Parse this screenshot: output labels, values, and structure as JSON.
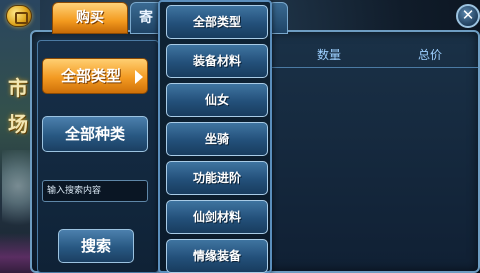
{
  "tabs": {
    "buy": "购买",
    "consign": "寄"
  },
  "market_title": [
    "市",
    "场"
  ],
  "filters": {
    "all_types": "全部类型",
    "all_kinds": "全部种类",
    "search_placeholder": "输入搜索内容",
    "search_button": "搜索"
  },
  "table_header": {
    "quantity": "数量",
    "total_price": "总价"
  },
  "dropdown_items": [
    "全部类型",
    "装备材料",
    "仙女",
    "坐骑",
    "功能进阶",
    "仙剑材料",
    "情缘装备"
  ],
  "colors": {
    "accent_orange": "#f39a1e",
    "panel_blue": "#1a3147",
    "header_text": "#9dd0ff"
  },
  "icons": {
    "coin": "coin-icon",
    "close": "close-icon",
    "arrow": "arrow-right-icon"
  }
}
